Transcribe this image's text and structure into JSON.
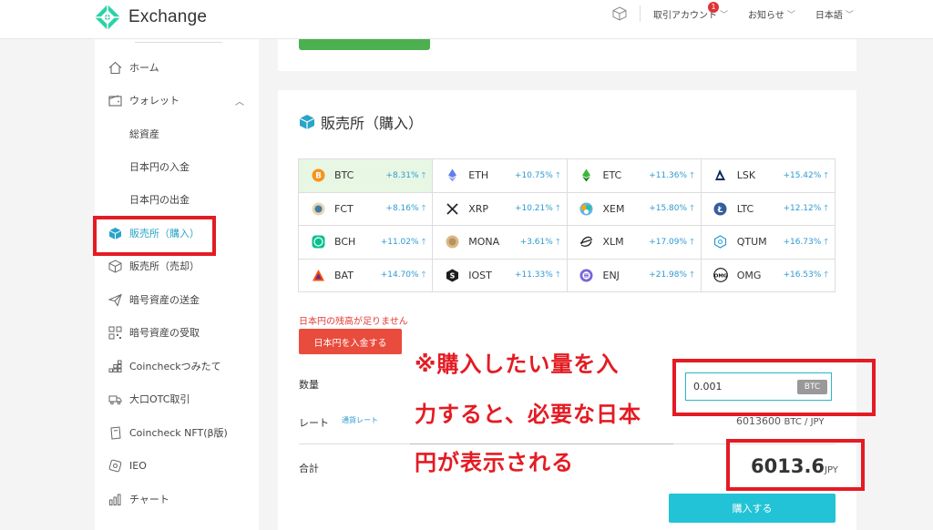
{
  "header": {
    "app_name": "Exchange",
    "nav": [
      {
        "label": "取引アカウント",
        "badge": "1"
      },
      {
        "label": "お知らせ"
      },
      {
        "label": "日本語"
      }
    ]
  },
  "sidebar": {
    "items": [
      {
        "label": "ホーム",
        "icon": "home-icon"
      },
      {
        "label": "ウォレット",
        "icon": "wallet-icon"
      },
      {
        "label": "総資産"
      },
      {
        "label": "日本円の入金"
      },
      {
        "label": "日本円の出金"
      },
      {
        "label": "販売所（購入）",
        "icon": "cube-icon"
      },
      {
        "label": "販売所（売却）",
        "icon": "cube-outline-icon"
      },
      {
        "label": "暗号資産の送金",
        "icon": "send-icon"
      },
      {
        "label": "暗号資産の受取",
        "icon": "qr-icon"
      },
      {
        "label": "Coincheckつみたて",
        "icon": "blocks-icon"
      },
      {
        "label": "大口OTC取引",
        "icon": "truck-icon"
      },
      {
        "label": "Coincheck NFT(β版)",
        "icon": "nft-icon"
      },
      {
        "label": "IEO",
        "icon": "ieo-icon"
      },
      {
        "label": "チャート",
        "icon": "chart-icon"
      }
    ]
  },
  "main": {
    "title": "販売所（購入）",
    "coins": [
      {
        "symbol": "BTC",
        "change": "+8.31%",
        "color": "#f7931a"
      },
      {
        "symbol": "ETH",
        "change": "+10.75%",
        "color": "#627eea"
      },
      {
        "symbol": "ETC",
        "change": "+11.36%",
        "color": "#3ab83a"
      },
      {
        "symbol": "LSK",
        "change": "+15.42%",
        "color": "#0d2c5a"
      },
      {
        "symbol": "FCT",
        "change": "+8.16%",
        "color": "#417ba4"
      },
      {
        "symbol": "XRP",
        "change": "+10.21%",
        "color": "#23292f"
      },
      {
        "symbol": "XEM",
        "change": "+15.80%",
        "color": "#67b2e8"
      },
      {
        "symbol": "LTC",
        "change": "+12.12%",
        "color": "#345d9d"
      },
      {
        "symbol": "BCH",
        "change": "+11.02%",
        "color": "#0ac18e"
      },
      {
        "symbol": "MONA",
        "change": "+3.61%",
        "color": "#b8925a"
      },
      {
        "symbol": "XLM",
        "change": "+17.09%",
        "color": "#222222"
      },
      {
        "symbol": "QTUM",
        "change": "+16.73%",
        "color": "#2e9ad0"
      },
      {
        "symbol": "BAT",
        "change": "+14.70%",
        "color": "#ff5000"
      },
      {
        "symbol": "IOST",
        "change": "+11.33%",
        "color": "#1c1c1c"
      },
      {
        "symbol": "ENJ",
        "change": "+21.98%",
        "color": "#7866d5"
      },
      {
        "symbol": "OMG",
        "change": "+16.53%",
        "color": "#101010"
      }
    ],
    "warning": "日本円の残高が足りません",
    "deposit_button": "日本円を入金する",
    "quantity_label": "数量",
    "quantity_value": "0.001",
    "quantity_unit": "BTC",
    "rate_label": "レート",
    "rate_sublabel": "通貨レート",
    "rate_value": "6013600",
    "rate_unit": "BTC / JPY",
    "total_label": "合計",
    "total_value": "6013.6",
    "total_unit": "JPY",
    "buy_button": "購入する"
  },
  "annotation": {
    "line1": "※購入したい量を入",
    "line2": "力すると、必要な日本",
    "line3": "円が表示される"
  },
  "colors": {
    "accent": "#22c3d6",
    "highlight_red": "#e41b23",
    "up_blue": "#2e9ad0",
    "selected_cell": "#e7f7e4"
  }
}
